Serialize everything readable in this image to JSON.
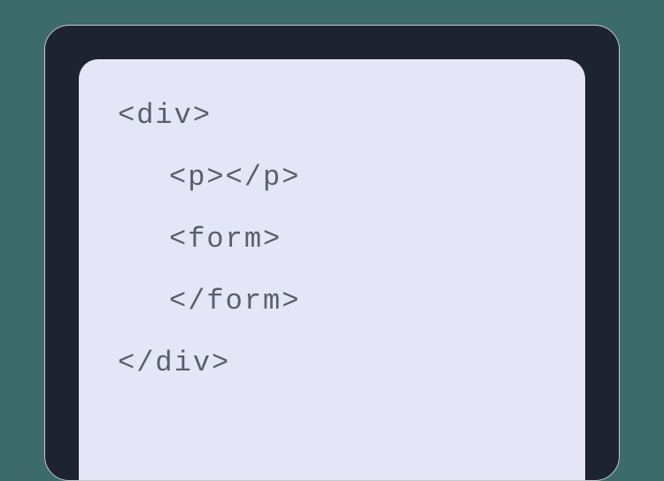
{
  "code": {
    "line1": "<div>",
    "line2": "<p></p>",
    "line3": "<form>",
    "line4": "</form>",
    "line5": "</div>"
  }
}
